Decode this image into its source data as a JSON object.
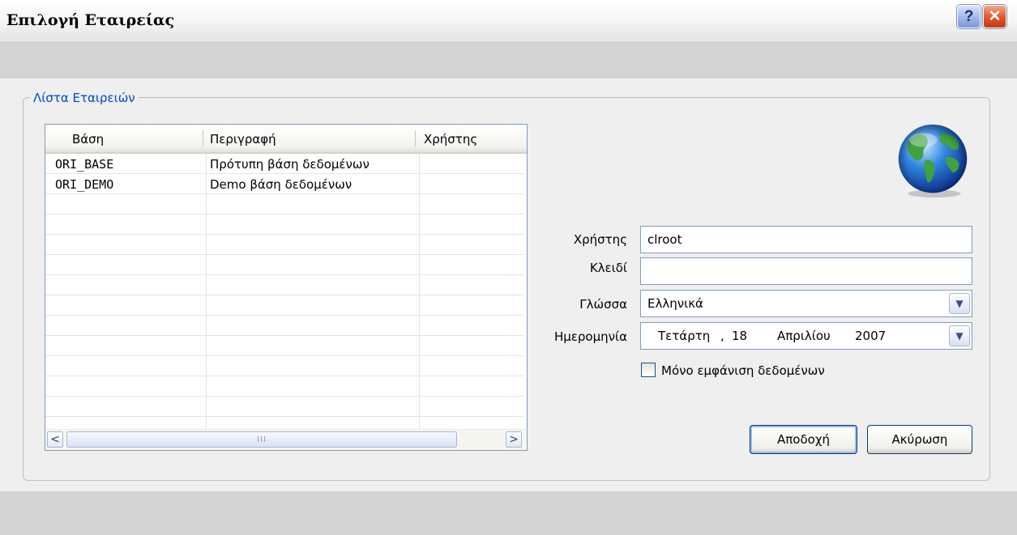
{
  "window": {
    "title": "Επιλογή Εταιρείας",
    "help_glyph": "?",
    "close_glyph": "✕"
  },
  "group": {
    "legend": "Λίστα Εταιρειών"
  },
  "list": {
    "columns": [
      "Βάση",
      "Περιγραφή",
      "Χρήστης"
    ],
    "rows": [
      {
        "base": "ORI_BASE",
        "description": "Πρότυπη βάση δεδομένων",
        "user": ""
      },
      {
        "base": "ORI_DEMO",
        "description": "Demo βάση δεδομένων",
        "user": ""
      }
    ],
    "scroll_left": "<",
    "scroll_right": ">",
    "thumb_grip": "III"
  },
  "form": {
    "user_label": "Χρήστης",
    "user_value": "clroot",
    "key_label": "Κλειδί",
    "key_value": "",
    "language_label": "Γλώσσα",
    "language_value": "Ελληνικά",
    "date_label": "Ημερομηνία",
    "date_weekday": "Τετάρτη",
    "date_sep": ",",
    "date_day": "18",
    "date_month": "Απριλίου",
    "date_year": "2007",
    "dropdown_glyph": "▼",
    "view_only_label": "Μόνο εμφάνιση δεδομένων",
    "view_only_checked": false
  },
  "buttons": {
    "accept": "Αποδοχή",
    "cancel": "Ακύρωση"
  },
  "icons": {
    "globe": "globe-icon"
  }
}
